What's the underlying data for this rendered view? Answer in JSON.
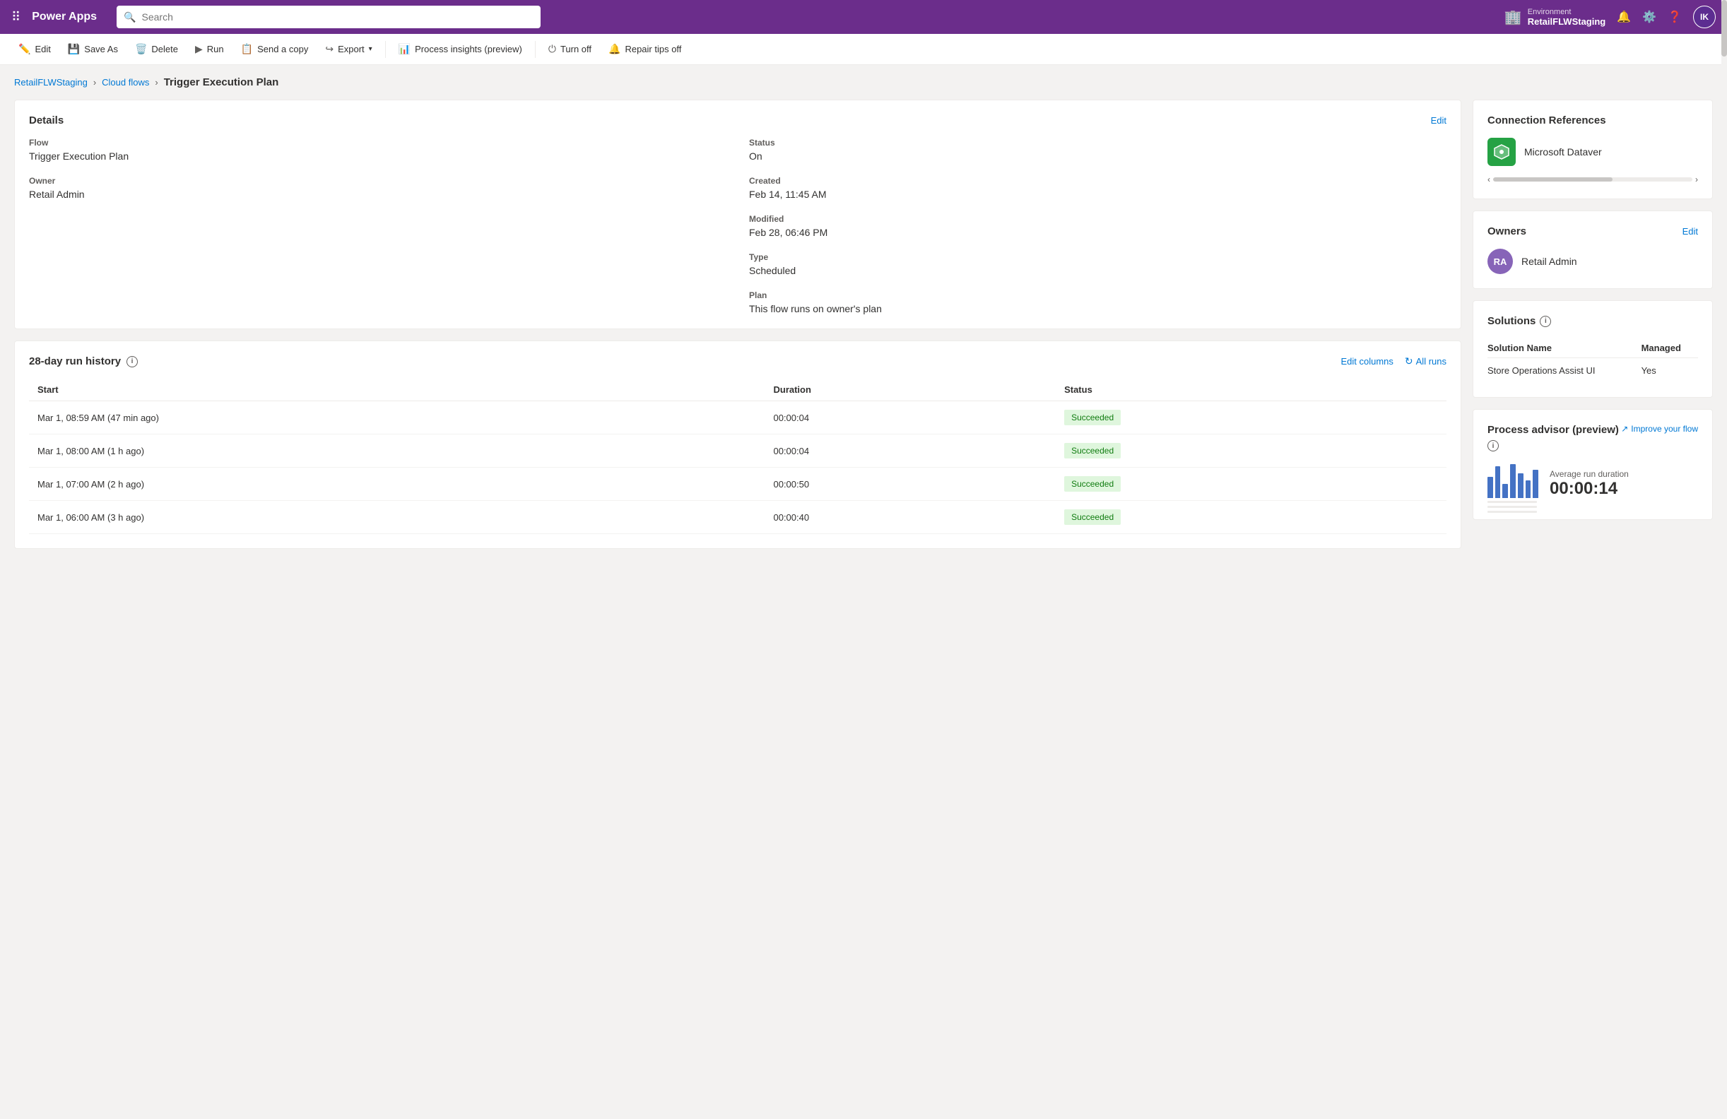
{
  "topNav": {
    "appName": "Power Apps",
    "searchPlaceholder": "Search",
    "environment": {
      "label": "Environment",
      "name": "RetailFLWStaging"
    },
    "userInitials": "IK"
  },
  "toolbar": {
    "editLabel": "Edit",
    "saveAsLabel": "Save As",
    "deleteLabel": "Delete",
    "runLabel": "Run",
    "sendCopyLabel": "Send a copy",
    "exportLabel": "Export",
    "processInsightsLabel": "Process insights (preview)",
    "turnOffLabel": "Turn off",
    "repairTipsLabel": "Repair tips off"
  },
  "breadcrumb": {
    "env": "RetailFLWStaging",
    "cloudFlows": "Cloud flows",
    "current": "Trigger Execution Plan"
  },
  "details": {
    "title": "Details",
    "editLabel": "Edit",
    "flowLabel": "Flow",
    "flowValue": "Trigger Execution Plan",
    "ownerLabel": "Owner",
    "ownerValue": "Retail Admin",
    "statusLabel": "Status",
    "statusValue": "On",
    "createdLabel": "Created",
    "createdValue": "Feb 14, 11:45 AM",
    "modifiedLabel": "Modified",
    "modifiedValue": "Feb 28, 06:46 PM",
    "typeLabel": "Type",
    "typeValue": "Scheduled",
    "planLabel": "Plan",
    "planValue": "This flow runs on owner's plan"
  },
  "runHistory": {
    "title": "28-day run history",
    "editColumnsLabel": "Edit columns",
    "allRunsLabel": "All runs",
    "columns": [
      "Start",
      "Duration",
      "Status"
    ],
    "rows": [
      {
        "start": "Mar 1, 08:59 AM (47 min ago)",
        "duration": "00:00:04",
        "status": "Succeeded"
      },
      {
        "start": "Mar 1, 08:00 AM (1 h ago)",
        "duration": "00:00:04",
        "status": "Succeeded"
      },
      {
        "start": "Mar 1, 07:00 AM (2 h ago)",
        "duration": "00:00:50",
        "status": "Succeeded"
      },
      {
        "start": "Mar 1, 06:00 AM (3 h ago)",
        "duration": "00:00:40",
        "status": "Succeeded"
      }
    ]
  },
  "connectionReferences": {
    "title": "Connection References",
    "connection": {
      "name": "Microsoft Dataver",
      "iconChar": "⬡"
    }
  },
  "owners": {
    "title": "Owners",
    "editLabel": "Edit",
    "owner": {
      "initials": "RA",
      "name": "Retail Admin"
    }
  },
  "solutions": {
    "title": "Solutions",
    "columns": [
      "Solution Name",
      "Managed"
    ],
    "rows": [
      {
        "name": "Store Operations Assist UI",
        "managed": "Yes"
      }
    ]
  },
  "processAdvisor": {
    "title": "Process advisor (preview)",
    "improveLabel": "Improve your flow",
    "avgLabel": "Average run duration",
    "avgDuration": "00:00:14",
    "chartBars": [
      30,
      45,
      20,
      50,
      35,
      25,
      40
    ]
  }
}
